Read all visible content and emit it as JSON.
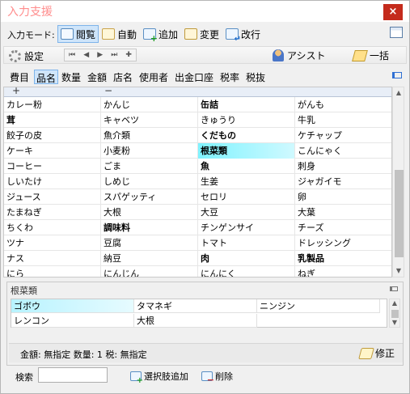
{
  "window": {
    "title": "入力支援",
    "close_glyph": "×"
  },
  "toolbar": {
    "mode_label": "入力モード:",
    "modes": [
      {
        "label": "閲覧",
        "icon": "browse-icon",
        "active": true
      },
      {
        "label": "自動",
        "icon": "auto-icon",
        "active": false
      },
      {
        "label": "追加",
        "icon": "add-icon",
        "active": false
      },
      {
        "label": "変更",
        "icon": "change-icon",
        "active": false
      },
      {
        "label": "改行",
        "icon": "newline-icon",
        "active": false
      }
    ]
  },
  "toolbar2": {
    "settings_label": "設定",
    "nav": [
      "⏮",
      "◀",
      "▶",
      "⏭",
      "✚"
    ],
    "assist_label": "アシスト",
    "batch_label": "一括"
  },
  "tabs": [
    "費目",
    "品名",
    "数量",
    "金額",
    "店名",
    "使用者",
    "出金口座",
    "税率",
    "税抜"
  ],
  "active_tab": "品名",
  "grid": {
    "header": [
      "+",
      "−"
    ],
    "rows": [
      [
        "カレー粉",
        "かんじ",
        "缶詰",
        "がんも"
      ],
      [
        "茸",
        "キャベツ",
        "きゅうり",
        "牛乳"
      ],
      [
        "餃子の皮",
        "魚介類",
        "くだもの",
        "ケチャップ"
      ],
      [
        "ケーキ",
        "小麦粉",
        "根菜類",
        "こんにゃく"
      ],
      [
        "コーヒー",
        "ごま",
        "魚",
        "刺身"
      ],
      [
        "しいたけ",
        "しめじ",
        "生姜",
        "ジャガイモ"
      ],
      [
        "ジュース",
        "スパゲッティ",
        "セロリ",
        "卵"
      ],
      [
        "たまねぎ",
        "大根",
        "大豆",
        "大葉"
      ],
      [
        "ちくわ",
        "調味料",
        "チンゲンサイ",
        "チーズ"
      ],
      [
        "ツナ",
        "豆腐",
        "トマト",
        "ドレッシング"
      ],
      [
        "ナス",
        "納豆",
        "肉",
        "乳製品"
      ],
      [
        "にら",
        "にんじん",
        "にんにく",
        "ねぎ"
      ]
    ],
    "bold": [
      "缶詰",
      "茸",
      "くだもの",
      "根菜類",
      "魚",
      "調味料",
      "肉",
      "乳製品"
    ],
    "selected": "根菜類"
  },
  "sub_panel": {
    "title": "根菜類",
    "items": [
      "ゴボウ",
      "タマネギ",
      "ニンジン",
      "レンコン",
      "大根"
    ],
    "selected": "ゴボウ"
  },
  "status": {
    "text": "金額: 無指定  数量: 1  税: 無指定",
    "edit_label": "修正"
  },
  "bottom": {
    "search_label": "検索",
    "search_value": "",
    "add_option_label": "選択肢追加",
    "delete_label": "削除"
  }
}
